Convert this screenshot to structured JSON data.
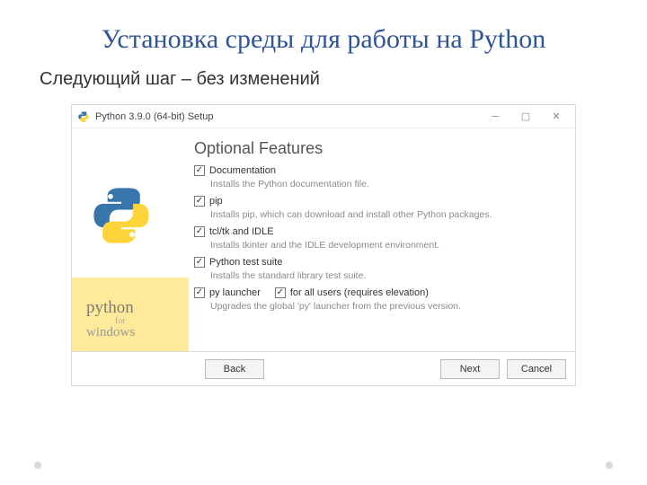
{
  "slide": {
    "title": "Установка среды для работы на Python",
    "subtitle": "Следующий шаг – без изменений"
  },
  "window": {
    "title": "Python 3.9.0 (64-bit) Setup",
    "heading": "Optional Features",
    "features": [
      {
        "label": "Documentation",
        "desc": "Installs the Python documentation file."
      },
      {
        "label": "pip",
        "desc": "Installs pip, which can download and install other Python packages."
      },
      {
        "label": "tcl/tk and IDLE",
        "desc": "Installs tkinter and the IDLE development environment."
      },
      {
        "label": "Python test suite",
        "desc": "Installs the standard library test suite."
      }
    ],
    "launcher": {
      "label": "py launcher",
      "all_users_label": "for all users (requires elevation)",
      "desc": "Upgrades the global 'py' launcher from the previous version."
    },
    "brand": {
      "l1": "python",
      "l2": "for",
      "l3": "windows"
    },
    "buttons": {
      "back": "Back",
      "next": "Next",
      "cancel": "Cancel"
    }
  }
}
